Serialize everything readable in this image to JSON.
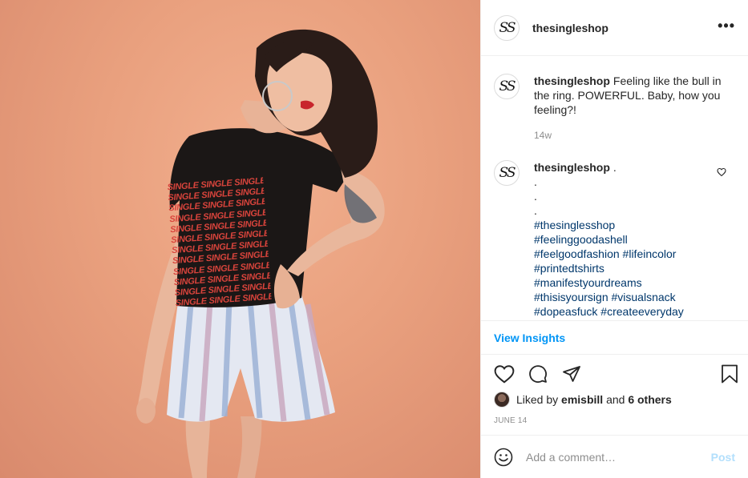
{
  "post": {
    "username": "thesingleshop",
    "avatar_initials": "SS",
    "more_label": "•••",
    "tee_print_word": "SINGLE SINGLE SINGLE"
  },
  "caption": {
    "username": "thesingleshop",
    "text": "Feeling like the bull in the ring. POWERFUL. Baby, how you feeling?!",
    "time": "14w"
  },
  "comment": {
    "username": "thesingleshop",
    "text": ".",
    "dots": [
      ".",
      ".",
      "."
    ],
    "hashtags": [
      [
        "#thesinglesshop"
      ],
      [
        "#feelinggoodashell"
      ],
      [
        "#feelgoodfashion",
        "#lifeincolor"
      ],
      [
        "#printedtshirts"
      ],
      [
        "#manifestyourdreams"
      ],
      [
        "#thisisyoursign",
        "#visualsnack"
      ],
      [
        "#dopeasfuck",
        "#createeveryday"
      ]
    ]
  },
  "insights": {
    "label": "View Insights"
  },
  "likes": {
    "prefix": "Liked by",
    "user": "emisbill",
    "conj": "and",
    "others": "6 others"
  },
  "date": "JUNE 14",
  "add_comment": {
    "placeholder": "Add a comment…",
    "post_label": "Post"
  },
  "colors": {
    "link": "#00376b",
    "accent": "#0095f6",
    "post_disabled": "#b2dffc",
    "muted": "#8e8e8e",
    "photo_bg": "#e9a07e"
  },
  "icons": {
    "header": "more-horizontal-icon",
    "actions": [
      "heart-icon",
      "comment-icon",
      "share-icon",
      "bookmark-icon"
    ],
    "comment_like": "heart-icon",
    "emoji": "emoji-icon"
  }
}
